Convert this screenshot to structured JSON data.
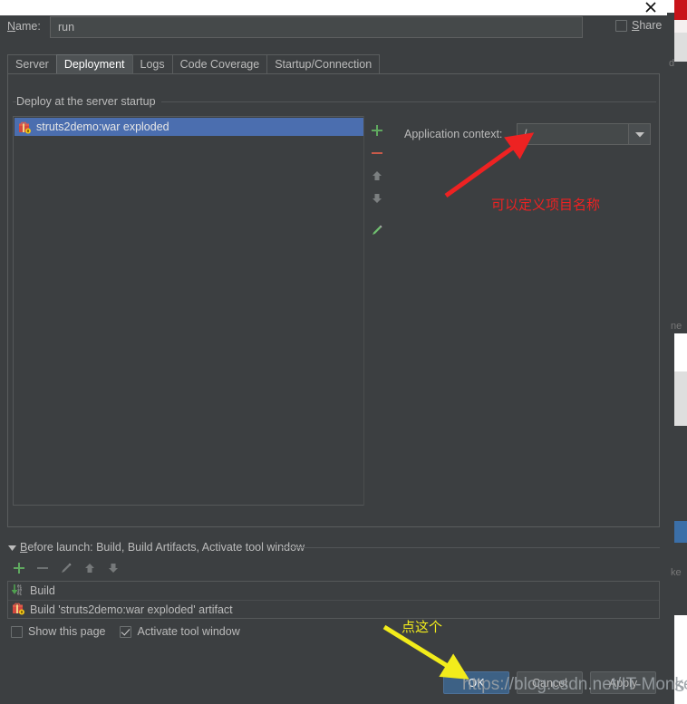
{
  "window": {
    "close_icon": "close-icon"
  },
  "name_row": {
    "label_prefix": "N",
    "label_rest": "ame:",
    "value": "run",
    "placeholder": "",
    "share_label": "Share",
    "share_checked": false
  },
  "tabs": [
    {
      "label": "Server",
      "selected": false
    },
    {
      "label": "Deployment",
      "selected": true
    },
    {
      "label": "Logs",
      "selected": false
    },
    {
      "label": "Code Coverage",
      "selected": false
    },
    {
      "label": "Startup/Connection",
      "selected": false
    }
  ],
  "deploy": {
    "group_title": "Deploy at the server startup",
    "items": [
      {
        "label": "struts2demo:war exploded",
        "icon": "artifact-icon",
        "selected": true
      }
    ],
    "toolbar": [
      {
        "name": "add-button",
        "icon": "plus-icon",
        "enabled": true
      },
      {
        "name": "remove-button",
        "icon": "minus-icon",
        "enabled": true
      },
      {
        "name": "move-up-button",
        "icon": "arrow-up-icon",
        "enabled": false
      },
      {
        "name": "move-down-button",
        "icon": "arrow-down-icon",
        "enabled": false
      },
      {
        "name": "edit-button",
        "icon": "pencil-icon",
        "enabled": true
      }
    ]
  },
  "application_context": {
    "label": "Application context:",
    "value": "/",
    "dropdown_icon": "chevron-down-icon"
  },
  "annotations": {
    "red_text": "可以定义项目名称",
    "yellow_text": "点这个",
    "red_color": "#ee2222",
    "yellow_color": "#f2ec1b"
  },
  "before_launch": {
    "title_prefix": "B",
    "title_rest": "efore launch: Build, Build Artifacts, Activate tool window",
    "toolbar": [
      {
        "name": "add-task-button",
        "icon": "plus-icon",
        "enabled": true
      },
      {
        "name": "remove-task-button",
        "icon": "minus-icon",
        "enabled": false
      },
      {
        "name": "edit-task-button",
        "icon": "pencil-icon",
        "enabled": false
      },
      {
        "name": "task-move-up-button",
        "icon": "arrow-up-icon",
        "enabled": false
      },
      {
        "name": "task-move-down-button",
        "icon": "arrow-down-icon",
        "enabled": false
      }
    ],
    "items": [
      {
        "label": "Build",
        "icon": "build-icon"
      },
      {
        "label": "Build 'struts2demo:war exploded' artifact",
        "icon": "artifact-icon"
      }
    ],
    "show_page_label": "Show this page",
    "show_page_checked": false,
    "activate_tool_window_label": "Activate tool window",
    "activate_tool_window_checked": true
  },
  "buttons": {
    "ok": "OK",
    "cancel": "Cancel",
    "apply": "Apply"
  },
  "watermark": "https://blog.csdn.net/IT-MonkeyS",
  "background": {
    "label_d": "d",
    "label_ne": "ne",
    "label_ke": "ke",
    "label_s": "S"
  }
}
